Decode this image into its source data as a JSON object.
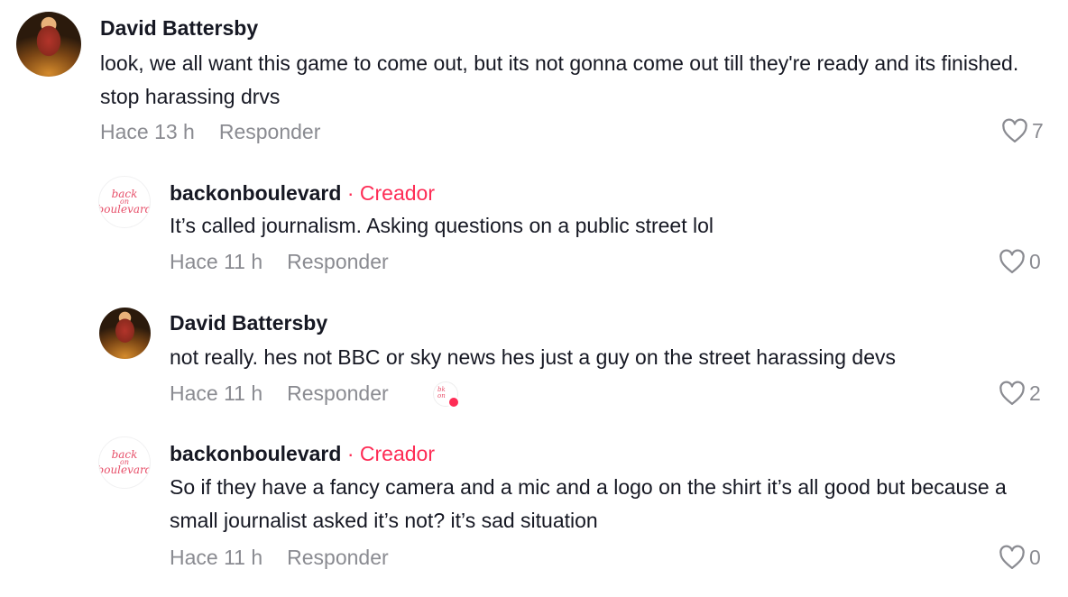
{
  "comments": [
    {
      "author": "David Battersby",
      "text": "look, we all want this game to come out, but its not gonna come out till they're ready and its finished. stop harassing drvs",
      "time": "Hace 13 h",
      "reply_label": "Responder",
      "likes": "7"
    },
    {
      "author": "backonboulevard",
      "creator_sep": "·",
      "creator_label": "Creador",
      "text": "It’s called journalism. Asking questions on a public street lol",
      "time": "Hace 11 h",
      "reply_label": "Responder",
      "likes": "0"
    },
    {
      "author": "David Battersby",
      "text": "not really. hes not BBC or sky news hes just a guy on the street harassing devs",
      "time": "Hace 11 h",
      "reply_label": "Responder",
      "likes": "2"
    },
    {
      "author": "backonboulevard",
      "creator_sep": "·",
      "creator_label": "Creador",
      "text": "So if they have a fancy camera and a mic and a logo on the shirt it’s all good but because a small journalist asked it’s not? it’s sad situation",
      "time": "Hace 11 h",
      "reply_label": "Responder",
      "likes": "0"
    }
  ],
  "logo_text": {
    "line1": "back",
    "line2": "on",
    "line3": "boulevard"
  },
  "colors": {
    "accent": "#fe2c55",
    "meta": "#8a8b91",
    "text": "#161823"
  }
}
